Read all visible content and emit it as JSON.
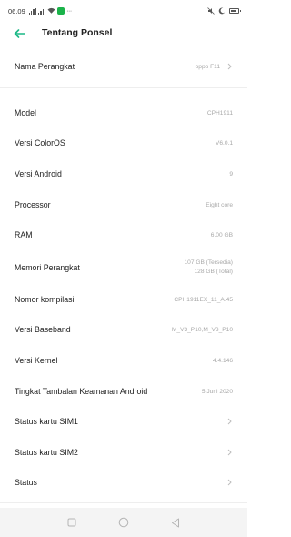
{
  "status_bar": {
    "time": "06.09",
    "extra_icons": "···"
  },
  "header": {
    "title": "Tentang Ponsel",
    "accent_color": "#1bb886"
  },
  "items": [
    {
      "label": "Nama Perangkat",
      "value": "oppo F11",
      "chevron": true
    },
    {
      "label": "Model",
      "value": "CPH1911",
      "chevron": false
    },
    {
      "label": "Versi ColorOS",
      "value": "V6.0.1",
      "chevron": false
    },
    {
      "label": "Versi Android",
      "value": "9",
      "chevron": false
    },
    {
      "label": "Processor",
      "value": "Eight core",
      "chevron": false
    },
    {
      "label": "RAM",
      "value": "6.00 GB",
      "chevron": false
    },
    {
      "label": "Memori Perangkat",
      "value_line1": "107 GB (Tersedia)",
      "value_line2": "128 GB (Total)",
      "chevron": false
    },
    {
      "label": "Nomor kompilasi",
      "value": "CPH1911EX_11_A.45",
      "chevron": false
    },
    {
      "label": "Versi Baseband",
      "value": "M_V3_P10,M_V3_P10",
      "chevron": false
    },
    {
      "label": "Versi Kernel",
      "value": "4.4.146",
      "chevron": false
    },
    {
      "label": "Tingkat Tambalan Keamanan Android",
      "value": "5 Juni 2020",
      "chevron": false
    },
    {
      "label": "Status kartu SIM1",
      "value": "",
      "chevron": true
    },
    {
      "label": "Status kartu SIM2",
      "value": "",
      "chevron": true
    },
    {
      "label": "Status",
      "value": "",
      "chevron": true
    }
  ],
  "icons": {
    "back": "arrow-left-icon",
    "chevron": "chevron-right-icon",
    "nav_recents": "square-icon",
    "nav_home": "circle-icon",
    "nav_back": "triangle-back-icon"
  }
}
